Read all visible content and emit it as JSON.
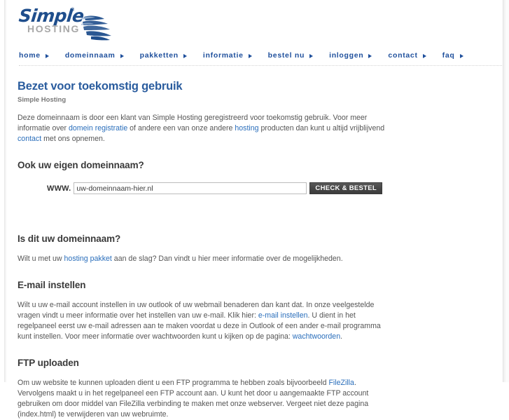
{
  "brand": {
    "logo_word": "Simple",
    "logo_registered": "®",
    "logo_sub": "HOSTING",
    "logo_mark_name": "feather-swoosh-icon",
    "accent_blue": "#1e4f9c",
    "link_blue": "#2a6ebb",
    "title_blue": "#2a5c9e",
    "heading_gray": "#3a3a3a",
    "body_gray": "#555555",
    "button_dark": "#474747"
  },
  "nav": {
    "items": [
      {
        "label": "home"
      },
      {
        "label": "domeinnaam"
      },
      {
        "label": "pakketten"
      },
      {
        "label": "informatie"
      },
      {
        "label": "bestel nu"
      },
      {
        "label": "inloggen"
      },
      {
        "label": "contact"
      },
      {
        "label": "faq"
      }
    ]
  },
  "main": {
    "page_title": "Bezet voor toekomstig gebruik",
    "subtitle": "Simple Hosting",
    "intro": {
      "part1": "Deze domeinnaam is door een klant van Simple Hosting geregistreerd voor toekomstig gebruik. Voor meer informatie over ",
      "link1": "domein registratie",
      "part2": " of andere een van onze andere ",
      "link2": "hosting",
      "part3": " producten dan kunt u altijd vrijblijvend ",
      "link3": "contact",
      "part4": " met ons opnemen."
    },
    "domain_section": {
      "heading": "Ook uw eigen domeinnaam?",
      "www_label": "WWW.",
      "input_value": "uw-domeinnaam-hier.nl",
      "input_placeholder": "uw-domeinnaam-hier.nl",
      "button_label": "CHECK & BESTEL"
    },
    "is_dit_section": {
      "heading": "Is dit uw domeinnaam?",
      "part1": "Wilt u met uw ",
      "link1": "hosting pakket",
      "part2": " aan de slag? Dan vindt u hier meer informatie over de mogelijkheden."
    },
    "email_section": {
      "heading": "E-mail instellen",
      "part1": "Wilt u uw e-mail account instellen in uw outlook of uw webmail benaderen dan kant dat. In onze veelgestelde vragen vindt u meer informatie over het instellen van uw e-mail. Klik hier: ",
      "link1": "e-mail instellen",
      "part2": ". U dient in het regelpaneel eerst uw e-mail adressen aan te maken voordat u deze in Outlook of een ander e-mail programma kunt instellen. Voor meer informatie over wachtwoorden kunt u kijken op de pagina: ",
      "link2": "wachtwoorden",
      "part3": "."
    },
    "ftp_section": {
      "heading": "FTP uploaden",
      "part1": "Om uw website te kunnen uploaden dient u een FTP programma te hebben zoals bijvoorbeeld ",
      "link1": "FileZilla",
      "part2": ". Vervolgens maakt u in het regelpaneel een FTP account aan. U kunt het door u aangemaakte FTP account gebruiken om door middel van FileZilla verbinding te maken met onze webserver. Vergeet niet deze pagina (index.html) te verwijderen van uw webruimte."
    }
  }
}
